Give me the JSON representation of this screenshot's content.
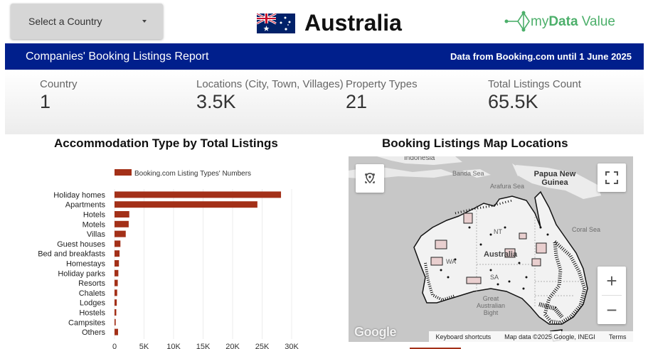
{
  "header": {
    "country_select_label": "Select a Country",
    "country_name": "Australia",
    "logo": {
      "prefix": "my",
      "bold": "Data",
      "suffix": " Value"
    }
  },
  "banner": {
    "title": "Companies' Booking Listings Report",
    "source": "Data from Booking.com until 1 June 2025"
  },
  "kpis": [
    {
      "label": "Country",
      "value": "1"
    },
    {
      "label": "Locations (City, Town, Villages)",
      "value": "3.5K"
    },
    {
      "label": "Property Types",
      "value": "21"
    },
    {
      "label": "Total Listings Count",
      "value": "65.5K"
    }
  ],
  "chart_title": "Accommodation Type by Total Listings",
  "map_title": "Booking Listings Map Locations",
  "chart_data": {
    "type": "bar",
    "orientation": "horizontal",
    "legend": "Booking.com Listing Types' Numbers",
    "legend_position": "top",
    "color": "#a33018",
    "categories": [
      "Holiday homes",
      "Apartments",
      "Hotels",
      "Motels",
      "Villas",
      "Guest houses",
      "Bed and breakfasts",
      "Homestays",
      "Holiday parks",
      "Resorts",
      "Chalets",
      "Lodges",
      "Hostels",
      "Campsites",
      "Others"
    ],
    "values": [
      28200,
      24200,
      2500,
      2400,
      1900,
      1000,
      850,
      750,
      650,
      550,
      450,
      380,
      300,
      200,
      600
    ],
    "xlim": [
      0,
      30000
    ],
    "xticks": [
      "0",
      "5K",
      "10K",
      "15K",
      "20K",
      "25K",
      "30K"
    ],
    "grid": true
  },
  "map": {
    "labels": {
      "indonesia": "Indonesia",
      "banda_sea": "Banda Sea",
      "arafura_sea": "Arafura Sea",
      "papua_new_guinea": "Papua New Guinea",
      "coral_sea": "Coral Sea",
      "nt": "NT",
      "australia": "Australia",
      "wa": "WA",
      "sa": "SA",
      "great_australian_bight": "Great Australian Bight"
    },
    "footer": {
      "keyboard_shortcuts": "Keyboard shortcuts",
      "map_data": "Map data ©2025 Google, INEGI",
      "terms": "Terms"
    },
    "google": "Google",
    "zoom_in": "+",
    "zoom_out": "−"
  }
}
